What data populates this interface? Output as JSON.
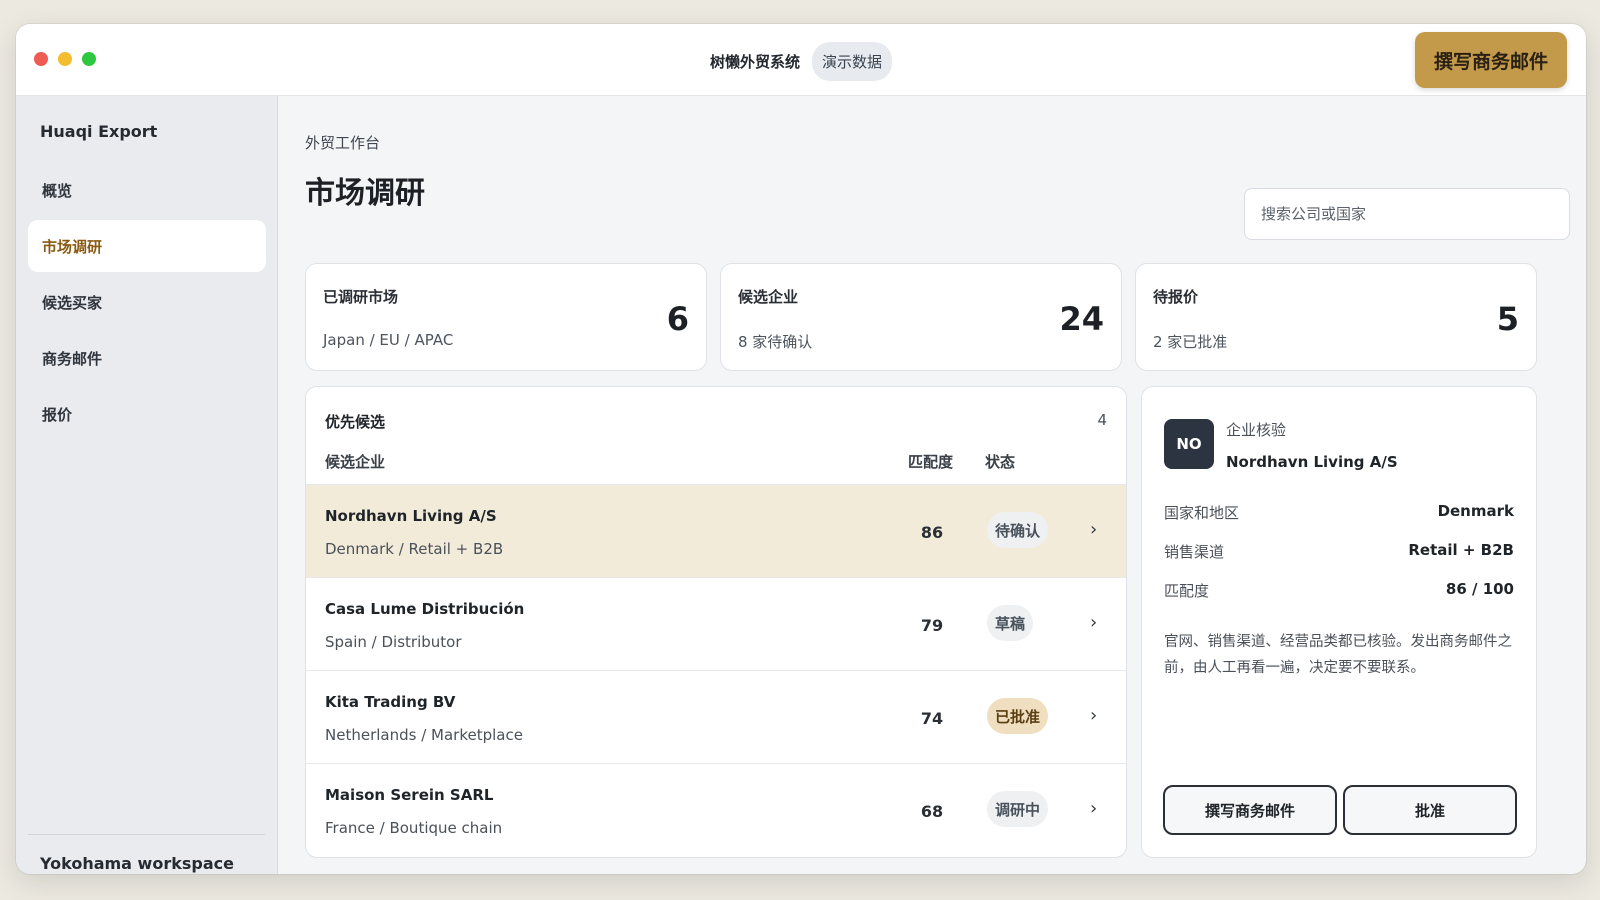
{
  "titlebar": {
    "app_name": "树懒外贸系统",
    "demo_badge": "演示数据",
    "compose_button": "撰写商务邮件"
  },
  "sidebar": {
    "brand": "Huaqi Export",
    "items": [
      {
        "label": "概览"
      },
      {
        "label": "市场调研",
        "active": true
      },
      {
        "label": "候选买家"
      },
      {
        "label": "商务邮件"
      },
      {
        "label": "报价"
      }
    ],
    "workspace": "Yokohama workspace"
  },
  "header": {
    "breadcrumb": "外贸工作台",
    "title": "市场调研",
    "search_placeholder": "搜索公司或国家"
  },
  "stats": [
    {
      "label": "已调研市场",
      "sub": "Japan / EU / APAC",
      "value": "6"
    },
    {
      "label": "候选企业",
      "sub": "8 家待确认",
      "value": "24"
    },
    {
      "label": "待报价",
      "sub": "2 家已批准",
      "value": "5"
    }
  ],
  "candidates": {
    "title": "优先候选",
    "count": "4",
    "columns": {
      "company": "候选企业",
      "score": "匹配度",
      "status": "状态"
    },
    "rows": [
      {
        "name": "Nordhavn Living A/S",
        "meta": "Denmark / Retail + B2B",
        "score": "86",
        "status": "待确认",
        "selected": true
      },
      {
        "name": "Casa Lume Distribución",
        "meta": "Spain / Distributor",
        "score": "79",
        "status": "草稿"
      },
      {
        "name": "Kita Trading BV",
        "meta": "Netherlands / Marketplace",
        "score": "74",
        "status": "已批准"
      },
      {
        "name": "Maison Serein SARL",
        "meta": "France / Boutique chain",
        "score": "68",
        "status": "调研中"
      }
    ],
    "chevron": "›"
  },
  "detail": {
    "avatar": "NO",
    "kicker": "企业核验",
    "company": "Nordhavn Living A/S",
    "fields": [
      {
        "label": "国家和地区",
        "value": "Denmark"
      },
      {
        "label": "销售渠道",
        "value": "Retail + B2B"
      },
      {
        "label": "匹配度",
        "value": "86 / 100"
      }
    ],
    "note": "官网、销售渠道、经营品类都已核验。发出商务邮件之前，由人工再看一遍，决定要不要联系。",
    "compose_button": "撰写商务邮件",
    "approve_button": "批准"
  },
  "colors": {
    "accent": "#c39a4a",
    "selected_row": "#f3ebda",
    "avatar": "#2b3440"
  }
}
